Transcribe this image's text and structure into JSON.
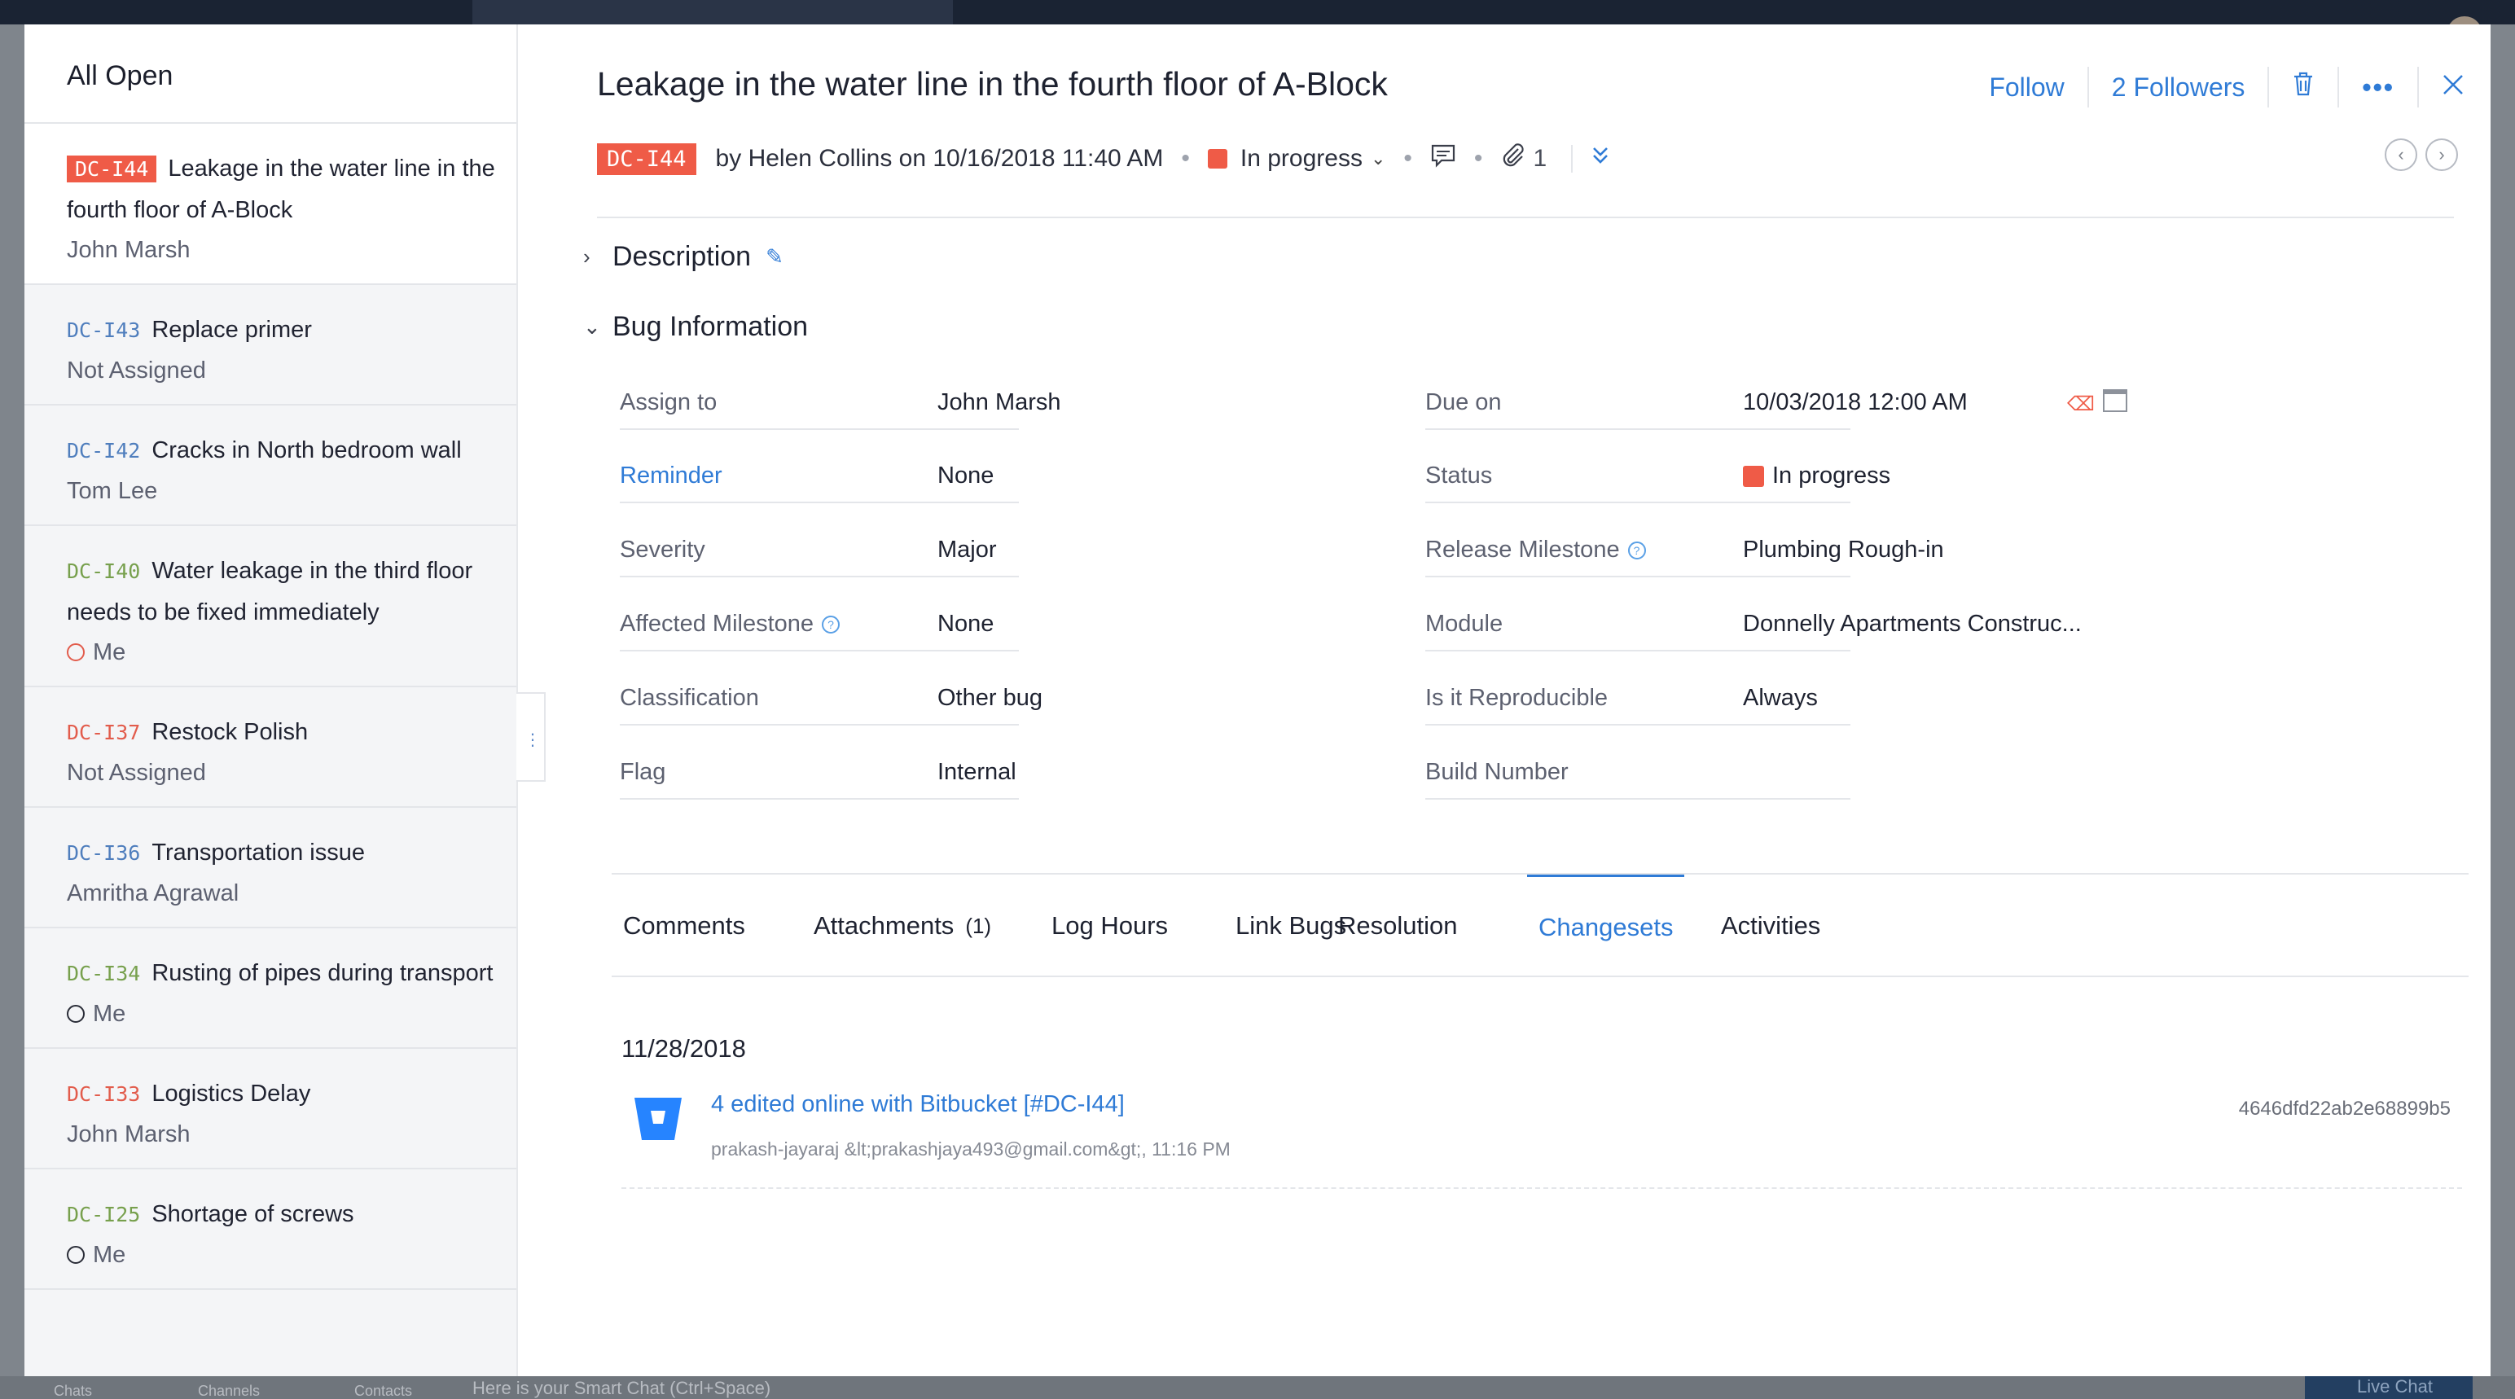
{
  "bottom_bar": {
    "chats": "Chats",
    "channels": "Channels",
    "contacts": "Contacts",
    "smart_chat_placeholder": "Here is your Smart Chat (Ctrl+Space)",
    "live_chat": "Live Chat"
  },
  "list": {
    "header": "All Open",
    "items": [
      {
        "key": "DC-I44",
        "title": "Leakage in the water line in the fourth floor of A-Block",
        "assignee": "John Marsh",
        "key_color": "badge",
        "active": true,
        "clock": null
      },
      {
        "key": "DC-I43",
        "title": "Replace primer",
        "assignee": "Not Assigned",
        "key_color": "blue",
        "clock": null
      },
      {
        "key": "DC-I42",
        "title": "Cracks in North bedroom wall",
        "assignee": "Tom Lee",
        "key_color": "blue",
        "clock": null
      },
      {
        "key": "DC-I40",
        "title": "Water leakage in the third floor needs to be fixed immediately",
        "assignee": "Me",
        "key_color": "green",
        "clock": "red"
      },
      {
        "key": "DC-I37",
        "title": "Restock Polish",
        "assignee": "Not Assigned",
        "key_color": "red",
        "clock": null
      },
      {
        "key": "DC-I36",
        "title": "Transportation issue",
        "assignee": "Amritha Agrawal",
        "key_color": "blue",
        "clock": null
      },
      {
        "key": "DC-I34",
        "title": "Rusting of pipes during transport",
        "assignee": "Me",
        "key_color": "green",
        "clock": "dark"
      },
      {
        "key": "DC-I33",
        "title": "Logistics Delay",
        "assignee": "John Marsh",
        "key_color": "red",
        "clock": null
      },
      {
        "key": "DC-I25",
        "title": "Shortage of screws",
        "assignee": "Me",
        "key_color": "green",
        "clock": "dark"
      }
    ]
  },
  "detail": {
    "title": "Leakage in the water line in the fourth floor of A-Block",
    "follow": "Follow",
    "followers": "2 Followers",
    "key": "DC-I44",
    "reporter": "by Helen Collins on 10/16/2018 11:40 AM",
    "status": "In progress",
    "attachment_count": "1",
    "description_label": "Description",
    "bug_info_label": "Bug Information"
  },
  "fields_left": [
    {
      "label": "Assign to",
      "value": "John Marsh",
      "link": false,
      "help": false
    },
    {
      "label": "Reminder",
      "value": "None",
      "link": true,
      "help": false
    },
    {
      "label": "Severity",
      "value": "Major",
      "link": false,
      "help": false
    },
    {
      "label": "Affected Milestone",
      "value": "None",
      "link": false,
      "help": true
    },
    {
      "label": "Classification",
      "value": "Other bug",
      "link": false,
      "help": false
    },
    {
      "label": "Flag",
      "value": "Internal",
      "link": false,
      "help": false
    }
  ],
  "fields_right": [
    {
      "label": "Due on",
      "value": "10/03/2018 12:00 AM",
      "help": false
    },
    {
      "label": "Status",
      "value": "In progress",
      "help": false
    },
    {
      "label": "Release Milestone",
      "value": "Plumbing Rough-in",
      "help": true
    },
    {
      "label": "Module",
      "value": "Donnelly Apartments Construc...",
      "help": false
    },
    {
      "label": "Is it Reproducible",
      "value": "Always",
      "help": false
    },
    {
      "label": "Build Number",
      "value": "",
      "help": false
    }
  ],
  "tabs": [
    {
      "label": "Comments",
      "count": ""
    },
    {
      "label": "Attachments",
      "count": "(1)"
    },
    {
      "label": "Log Hours",
      "count": ""
    },
    {
      "label": "Link Bugs",
      "count": ""
    },
    {
      "label": "Resolution",
      "count": ""
    },
    {
      "label": "Changesets",
      "count": "",
      "active": true
    },
    {
      "label": "Activities",
      "count": ""
    }
  ],
  "changeset": {
    "date": "11/28/2018",
    "message": "4 edited online with Bitbucket [#DC-I44]",
    "author": "prakash-jayaraj &lt;prakashjaya493@gmail.com&gt;, 11:16 PM",
    "hash": "4646dfd22ab2e68899b5"
  },
  "colors": {
    "accent": "#2f7bd6",
    "status_red": "#ef5b47",
    "bitbucket": "#2684ff"
  }
}
